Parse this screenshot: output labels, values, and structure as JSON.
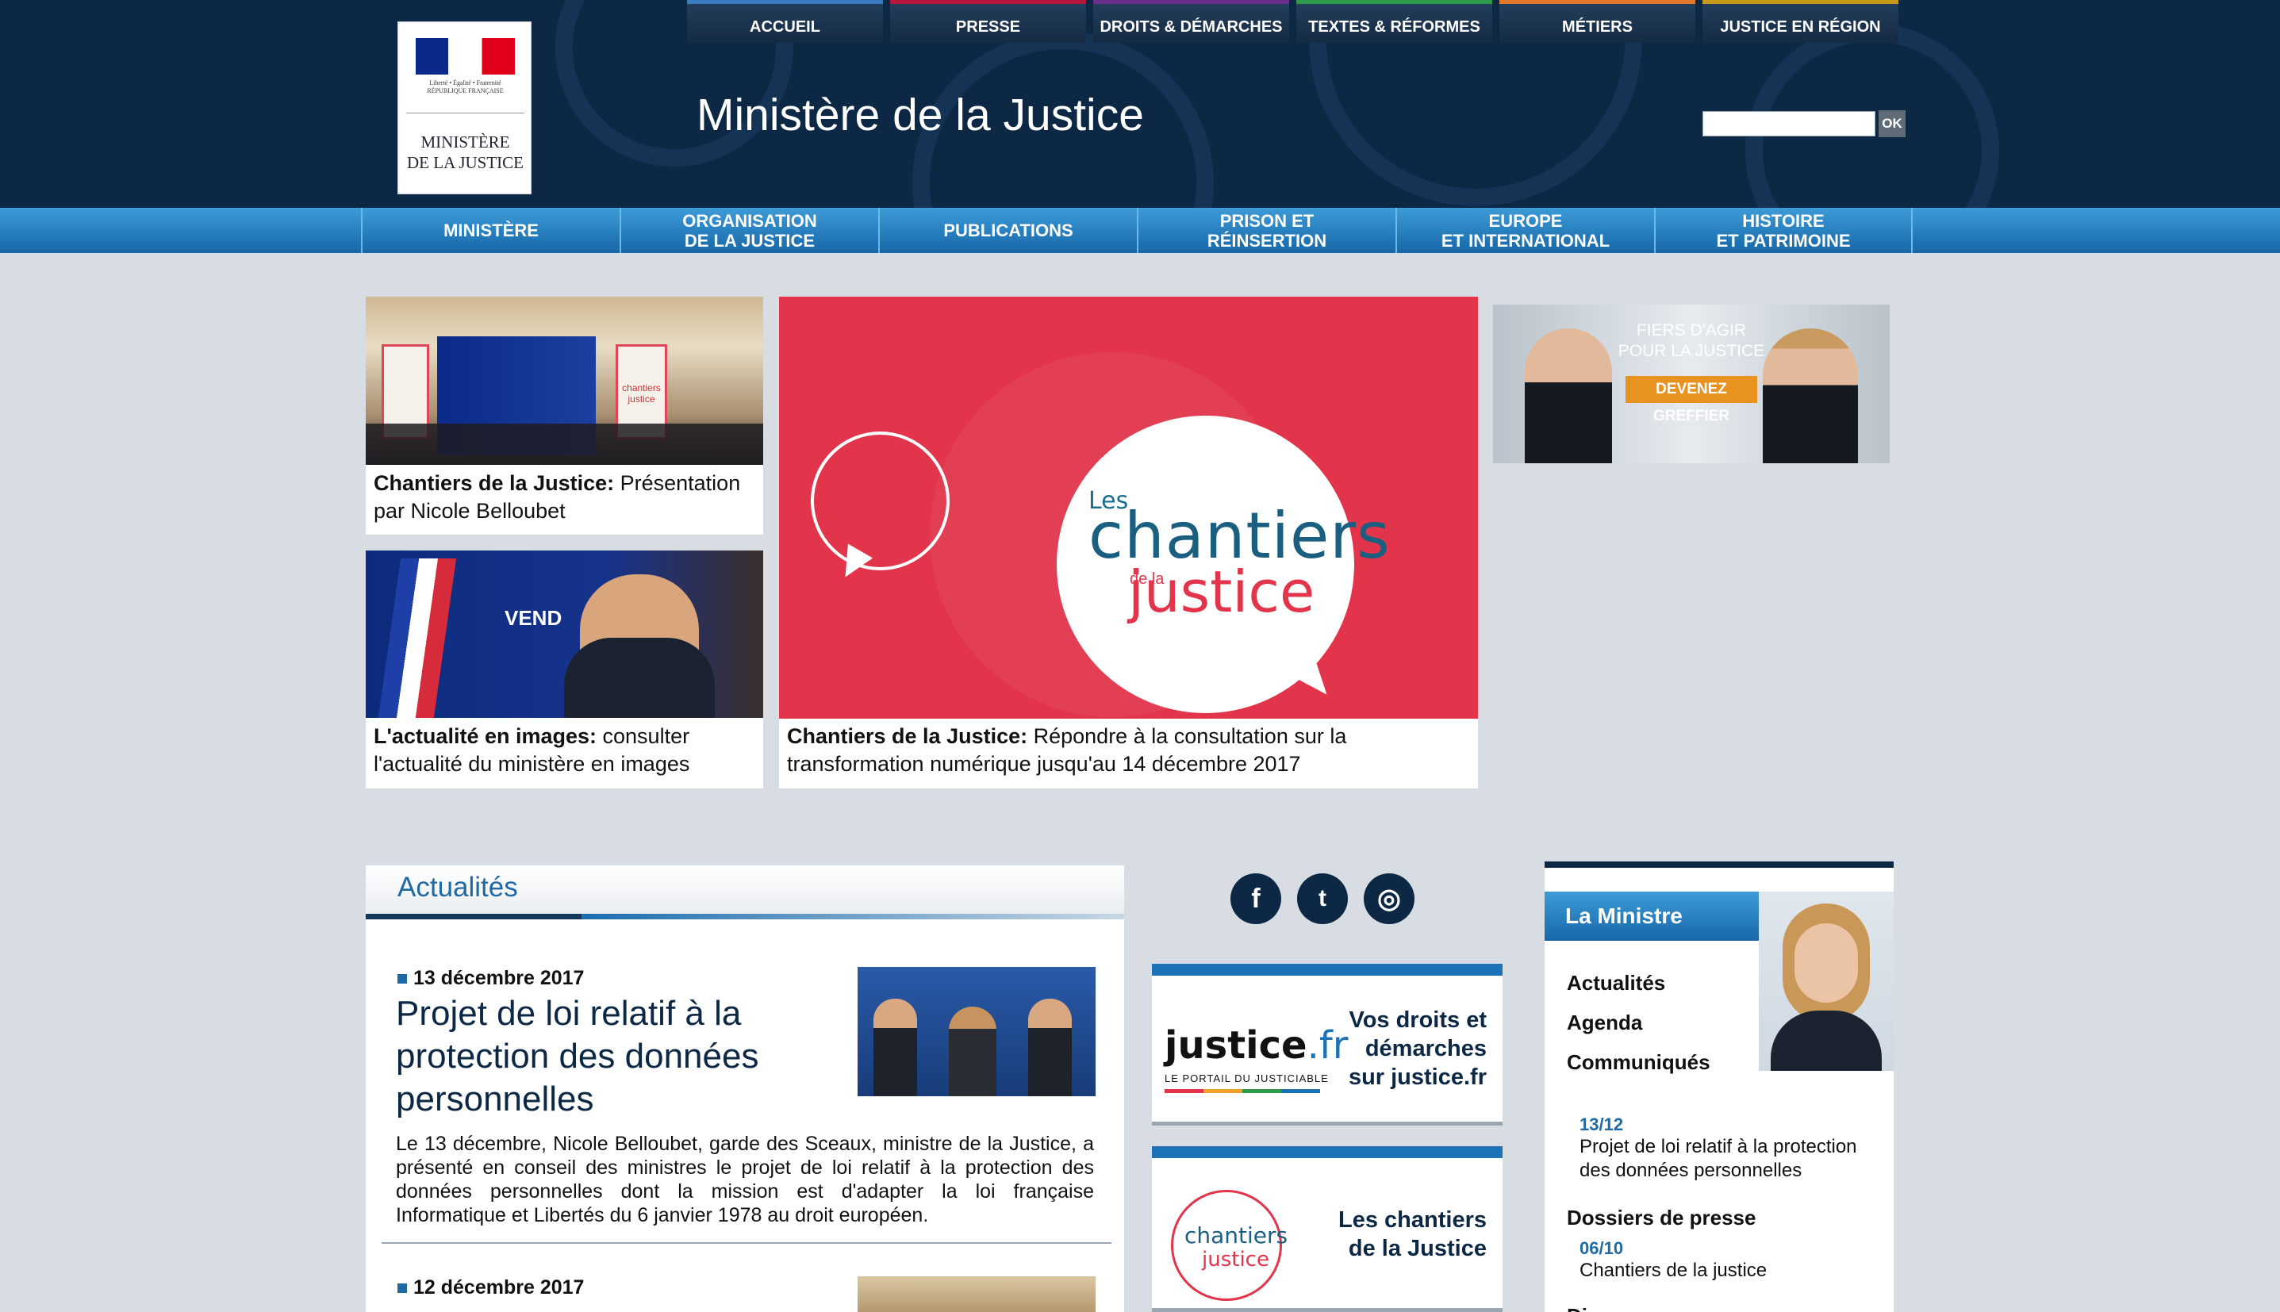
{
  "logo": {
    "motto": "Liberté • Égalité • Fraternité",
    "republic": "RÉPUBLIQUE FRANÇAISE",
    "name_line1": "MINISTÈRE",
    "name_line2": "DE LA JUSTICE"
  },
  "top_nav": [
    {
      "label": "ACCUEIL",
      "color": "#3a7cc0"
    },
    {
      "label": "PRESSE",
      "color": "#b5173b"
    },
    {
      "label": "DROITS & DÉMARCHES",
      "color": "#6a2e8c"
    },
    {
      "label": "TEXTES & RÉFORMES",
      "color": "#2f9a4a"
    },
    {
      "label": "MÉTIERS",
      "color": "#e4782a"
    },
    {
      "label": "JUSTICE EN RÉGION",
      "color": "#c99a1b"
    }
  ],
  "site_title": "Ministère de la Justice",
  "search": {
    "value": "",
    "button": "OK"
  },
  "main_nav": [
    "MINISTÈRE",
    "ORGANISATION\nDE LA JUSTICE",
    "PUBLICATIONS",
    "PRISON ET\nRÉINSERTION",
    "EUROPE\nET INTERNATIONAL",
    "HISTOIRE\nET PATRIMOINE"
  ],
  "featured": {
    "card1": {
      "bold": "Chantiers de la Justice:",
      "text": " Présentation par Nicole Belloubet",
      "poster": "chantiers justice"
    },
    "card2": {
      "bold": "L'actualité en images:",
      "text": " consulter l'actualité du ministère en images",
      "screen": "VEND"
    },
    "main": {
      "bold": "Chantiers de la Justice:",
      "text": " Répondre à la consultation sur la transformation numérique jusqu'au 14 décembre 2017",
      "logo_les": "Les",
      "logo_chantiers": "chantiers",
      "logo_dela": "de la",
      "logo_justice": "justice"
    },
    "banner": {
      "line1": "FIERS D'AGIR",
      "line2": "POUR LA JUSTICE",
      "cta": "DEVENEZ GREFFIER"
    }
  },
  "actualites": {
    "title": "Actualités",
    "items": [
      {
        "date": "13 décembre 2017",
        "title": "Projet de loi relatif à la protection des données personnelles",
        "summary": "Le 13 décembre, Nicole Belloubet, garde des Sceaux, ministre de la Justice, a présenté en conseil des ministres le projet de loi relatif à la protection des données personnelles dont la mission est d'adapter la loi française Informatique et Libertés du 6 janvier 1978 au droit européen."
      },
      {
        "date": "12 décembre 2017",
        "title": ""
      }
    ]
  },
  "social": {
    "facebook": "f",
    "twitter": "t",
    "instagram": "◎"
  },
  "portals": {
    "justice_fr": {
      "logo": "justice",
      "logo_suffix": ".fr",
      "logo_sub": "LE PORTAIL DU JUSTICIABLE",
      "text": "Vos droits et démarches sur justice.fr"
    },
    "chantiers": {
      "logo_chantiers": "chantiers",
      "logo_justice": "justice",
      "text": "Les chantiers de la Justice"
    }
  },
  "sidebar": {
    "tab": "La Ministre",
    "links": [
      "Actualités",
      "Agenda",
      "Communiqués"
    ],
    "communique": {
      "date": "13/12",
      "text": "Projet de loi relatif à la protection des données personnelles"
    },
    "dossiers_title": "Dossiers de presse",
    "dossier": {
      "date": "06/10",
      "text": "Chantiers de la justice"
    },
    "discours": "Discours"
  }
}
